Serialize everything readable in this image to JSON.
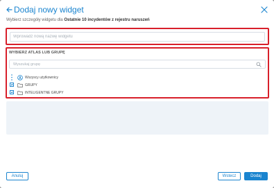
{
  "dialog": {
    "title": "Dodaj nowy widget",
    "subtitle_prefix": "Wybierz szczegóły widgetu dla ",
    "subtitle_bold": "Ostatnie 10 incydentów z rejestru naruszeń"
  },
  "name_field": {
    "placeholder": "Wprowadź nową nazwę widgetu",
    "value": ""
  },
  "group_section": {
    "label": "WYBIERZ ATLAS LUB GRUPĘ",
    "search_placeholder": "Wyszukaj grupę",
    "tree": [
      {
        "label": "Wszyscy użytkownicy",
        "icon": "users-icon",
        "lead": "dots-icon"
      },
      {
        "label": "GRUPY",
        "icon": "folder-icon",
        "lead": "expand-icon"
      },
      {
        "label": "INTELIGENTNE GRUPY",
        "icon": "folder-icon",
        "lead": "expand-icon"
      }
    ]
  },
  "footer": {
    "cancel_label": "Anuluj",
    "back_label": "Wstecz",
    "add_label": "Dodaj"
  },
  "colors": {
    "accent": "#1a84cf",
    "highlight_border": "#d81f2a",
    "results_bg": "#eef3f8"
  }
}
